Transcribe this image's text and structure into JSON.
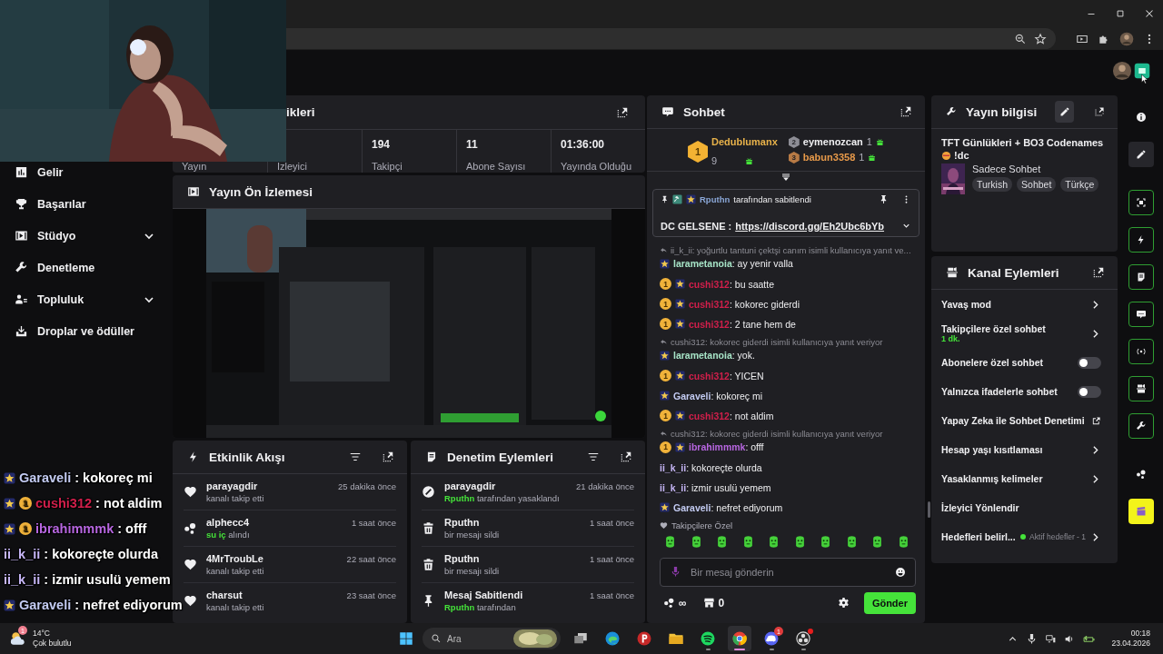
{
  "sidebar": {
    "items": [
      {
        "label": "Gelir",
        "has_submenu": false
      },
      {
        "label": "Başarılar",
        "has_submenu": false
      },
      {
        "label": "Stüdyo",
        "has_submenu": true
      },
      {
        "label": "Denetleme",
        "has_submenu": false
      },
      {
        "label": "Topluluk",
        "has_submenu": true
      },
      {
        "label": "Droplar ve ödüller",
        "has_submenu": false
      }
    ]
  },
  "stats": {
    "title": "ikleri",
    "items": [
      {
        "label": "Yayın"
      },
      {
        "label": "İzleyici"
      },
      {
        "value": "194",
        "label": "Takipçi"
      },
      {
        "value": "11",
        "label": "Abone Sayısı"
      },
      {
        "value": "01:36:00",
        "label": "Yayında Olduğu"
      }
    ]
  },
  "preview": {
    "title": "Yayın Ön İzlemesi"
  },
  "activity": {
    "title": "Etkinlik Akışı",
    "items": [
      {
        "kind": "follow",
        "title": "parayagdir",
        "detail": "kanalı takip etti",
        "time": "25 dakika önce"
      },
      {
        "kind": "reward",
        "title": "alphecc4",
        "highlight": "su iç",
        "detail": "alındı",
        "time": "1 saat önce"
      },
      {
        "kind": "follow",
        "title": "4MrTroubLe",
        "detail": "kanalı takip etti",
        "time": "22 saat önce"
      },
      {
        "kind": "follow",
        "title": "charsut",
        "detail": "kanalı takip etti",
        "time": "23 saat önce"
      }
    ]
  },
  "moderation": {
    "title": "Denetim Eylemleri",
    "items": [
      {
        "kind": "ban",
        "title": "parayagdir",
        "highlight": "Rputhn",
        "detail": "tarafından yasaklandı",
        "time": "21 dakika önce"
      },
      {
        "kind": "delete",
        "title": "Rputhn",
        "detail": "bir mesajı sildi",
        "time": "1 saat önce"
      },
      {
        "kind": "delete",
        "title": "Rputhn",
        "detail": "bir mesajı sildi",
        "time": "1 saat önce"
      },
      {
        "kind": "pin",
        "title": "Mesaj Sabitlendi",
        "highlight": "Rputhn",
        "detail": "tarafından",
        "time": "1 saat önce"
      }
    ]
  },
  "chat": {
    "title": "Sohbet",
    "leaderboard": [
      {
        "rank": "1",
        "name": "Dedublumanx",
        "count": "9",
        "color": "#e8b24a"
      },
      {
        "rank": "2",
        "name": "eymenozcan",
        "count": "1",
        "color": "#efeff1"
      },
      {
        "rank": "3",
        "name": "babun3358",
        "count": "1",
        "color": "#e89a4a"
      }
    ],
    "pinned": {
      "by": "Rputhn",
      "label": "tarafından sabitlendi",
      "text": "DC GELSENE :",
      "link": "https://discord.gg/Eh2Ubc6bYb"
    },
    "messages": [
      {
        "kind": "reply",
        "text": "ii_k_ii: yoğurtlu tantuni çektşi canım isimli kullanıcıya yanıt ve..."
      },
      {
        "kind": "message",
        "badges": [
          {
            "kind": "star"
          }
        ],
        "user": "larametanoia",
        "color": "#a6e3c6",
        "text": ": ay yenir valla"
      },
      {
        "kind": "message",
        "badges": [
          {
            "kind": "bits",
            "text": "1"
          },
          {
            "kind": "star"
          }
        ],
        "user": "cushi312",
        "color": "#d21f4b",
        "text": ": bu saatte"
      },
      {
        "kind": "message",
        "badges": [
          {
            "kind": "bits",
            "text": "1"
          },
          {
            "kind": "star"
          }
        ],
        "user": "cushi312",
        "color": "#d21f4b",
        "text": ": kokorec giderdi"
      },
      {
        "kind": "message",
        "badges": [
          {
            "kind": "bits",
            "text": "1"
          },
          {
            "kind": "star"
          }
        ],
        "user": "cushi312",
        "color": "#d21f4b",
        "text": ": 2 tane hem de"
      },
      {
        "kind": "reply",
        "text": "cushi312: kokorec giderdi isimli kullanıcıya yanıt veriyor"
      },
      {
        "kind": "message",
        "badges": [
          {
            "kind": "star"
          }
        ],
        "user": "larametanoia",
        "color": "#a6e3c6",
        "text": ": yok."
      },
      {
        "kind": "message",
        "badges": [
          {
            "kind": "bits",
            "text": "1"
          },
          {
            "kind": "star"
          }
        ],
        "user": "cushi312",
        "color": "#d21f4b",
        "text": ": YICEN"
      },
      {
        "kind": "message",
        "badges": [
          {
            "kind": "star"
          }
        ],
        "user": "Garaveli",
        "color": "#c3cbf2",
        "text": ": kokoreç mi"
      },
      {
        "kind": "message",
        "badges": [
          {
            "kind": "bits",
            "text": "1"
          },
          {
            "kind": "star"
          }
        ],
        "user": "cushi312",
        "color": "#d21f4b",
        "text": ": not aldim"
      },
      {
        "kind": "reply",
        "text": "cushi312: kokorec giderdi isimli kullanıcıya yanıt veriyor"
      },
      {
        "kind": "message",
        "badges": [
          {
            "kind": "bits",
            "text": "1"
          },
          {
            "kind": "star"
          }
        ],
        "user": "ibrahimmmk",
        "color": "#b766e0",
        "text": ": offf"
      },
      {
        "kind": "message",
        "user": "ii_k_ii",
        "color": "#c6b6f6",
        "text": ": kokoreçte olurda"
      },
      {
        "kind": "message",
        "user": "ii_k_ii",
        "color": "#c6b6f6",
        "text": ": izmir usulü yemem"
      },
      {
        "kind": "message",
        "badges": [
          {
            "kind": "star"
          }
        ],
        "user": "Garaveli",
        "color": "#c3cbf2",
        "text": ": nefret ediyorum"
      }
    ],
    "emote_label": "Takipçilere Özel",
    "input": {
      "placeholder": "Bir mesaj gönderin"
    },
    "points": "∞",
    "bits": "0",
    "send": "Gönder"
  },
  "stream_info": {
    "title": "Yayın bilgisi",
    "stream_title": "TFT Günlükleri + BO3 Codenames",
    "command": "!dc",
    "category": "Sadece Sohbet",
    "tags": [
      "Turkish",
      "Sohbet",
      "Türkçe"
    ]
  },
  "channel_actions": {
    "title": "Kanal Eylemleri",
    "items": [
      {
        "kind": "chevron",
        "label": "Yavaş mod"
      },
      {
        "kind": "chevron",
        "label": "Takipçilere özel sohbet",
        "sub": "1 dk."
      },
      {
        "kind": "toggle",
        "label": "Abonelere özel sohbet",
        "on": false
      },
      {
        "kind": "toggle",
        "label": "Yalnızca ifadelerle sohbet",
        "on": false
      },
      {
        "kind": "external",
        "label": "Yapay Zeka ile Sohbet Denetimi"
      },
      {
        "kind": "chevron",
        "label": "Hesap yaşı kısıtlaması"
      },
      {
        "kind": "chevron",
        "label": "Yasaklanmış kelimeler"
      },
      {
        "kind": "plain",
        "label": "İzleyici Yönlendir"
      },
      {
        "kind": "goal",
        "label": "Hedefleri belirl...",
        "status": "Aktif hedefler - 1"
      }
    ]
  },
  "rail": {
    "items": [
      {
        "kind": "info",
        "active": false
      },
      {
        "kind": "edit",
        "active": false
      },
      {
        "kind": "focus",
        "active": true
      },
      {
        "kind": "bolt",
        "active": true
      },
      {
        "kind": "notes",
        "active": true
      },
      {
        "kind": "chat",
        "active": true
      },
      {
        "kind": "broadcast",
        "active": true
      },
      {
        "kind": "camera",
        "active": true
      },
      {
        "kind": "wrench",
        "active": true
      },
      {
        "kind": "points",
        "active": false
      },
      {
        "kind": "clapper",
        "active": false
      }
    ]
  },
  "overlay_chat": [
    {
      "badges": [
        {
          "kind": "star"
        }
      ],
      "user": "Garaveli",
      "color": "#c3cbf2",
      "text": ": kokoreç mi"
    },
    {
      "badges": [
        {
          "kind": "star"
        },
        {
          "kind": "bits",
          "text": "1"
        }
      ],
      "user": "cushi312",
      "color": "#d21f4b",
      "text": ": not aldim"
    },
    {
      "badges": [
        {
          "kind": "star"
        },
        {
          "kind": "bits",
          "text": "1"
        }
      ],
      "user": "ibrahimmmk",
      "color": "#b766e0",
      "text": ": offf"
    },
    {
      "user": "ii_k_ii",
      "color": "#c6b6f6",
      "text": ": kokoreçte olurda"
    },
    {
      "user": "ii_k_ii",
      "color": "#c6b6f6",
      "text": ": izmir usulü yemem"
    },
    {
      "badges": [
        {
          "kind": "star"
        }
      ],
      "user": "Garaveli",
      "color": "#c3cbf2",
      "text": ": nefret ediyorum"
    }
  ],
  "taskbar": {
    "weather": {
      "badge": "1",
      "temp": "14°C",
      "desc": "Çok bulutlu"
    },
    "search": {
      "placeholder": "Ara"
    },
    "apps": [
      {
        "kind": "taskview",
        "running": false,
        "selected": false
      },
      {
        "kind": "edge",
        "running": false,
        "selected": false
      },
      {
        "kind": "psiphon",
        "running": false,
        "selected": false
      },
      {
        "kind": "files",
        "running": false,
        "selected": false
      },
      {
        "kind": "spotify",
        "running": true,
        "selected": false
      },
      {
        "kind": "chrome",
        "running": true,
        "selected": true
      },
      {
        "kind": "discord",
        "running": true,
        "selected": false,
        "badge": "1"
      },
      {
        "kind": "obs",
        "running": true,
        "selected": false
      }
    ],
    "time": "00:18",
    "date": "23.04.2026"
  }
}
